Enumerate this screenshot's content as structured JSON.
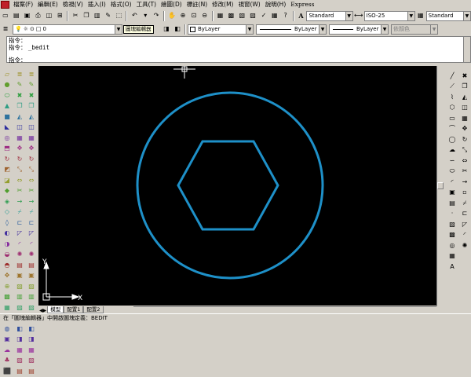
{
  "menu": [
    "檔案(F)",
    "編輯(E)",
    "檢視(V)",
    "插入(I)",
    "格式(O)",
    "工具(T)",
    "繪圖(D)",
    "標註(N)",
    "修改(M)",
    "視窗(W)",
    "說明(H)",
    "Express"
  ],
  "styles": {
    "text_style": "Standard",
    "dim_style": "ISO-25",
    "table_style": "Standard"
  },
  "layer": {
    "current": "0",
    "tooltip": "圖塊編輯器"
  },
  "properties": {
    "color": "ByLayer",
    "linetype": "ByLayer",
    "lineweight": "ByLayer",
    "plot_style": "依顏色"
  },
  "command": {
    "line1": "指令：",
    "line2_prompt": "指令：",
    "line2_cmd": "_bedit",
    "line3": "指令："
  },
  "ucs": {
    "x_label": "X",
    "y_label": "Y"
  },
  "tabs": [
    "模型",
    "配置1",
    "配置2"
  ],
  "status": "在「圖塊編輯器」中開啟圖塊定義：BEDIT",
  "colors": {
    "canvas_bg": "#000000",
    "geometry": "#1e90c8",
    "chrome": "#d4d0c8"
  },
  "icons": {
    "left_col1": [
      "plane-icon",
      "sphere-icon",
      "cylinder-icon",
      "cone-icon",
      "box-icon",
      "wedge-icon",
      "torus-icon",
      "extrude-icon",
      "revolve-icon",
      "slice-icon",
      "section-icon",
      "interfere-icon",
      "union-icon",
      "subtract-icon",
      "intersect-icon",
      "shade-icon",
      "hide-icon",
      "render-icon",
      "orbit-icon",
      "pan-icon",
      "zoom-icon",
      "view-icon",
      "camera-icon",
      "light-icon",
      "material-icon",
      "scene-icon",
      "fog-icon",
      "landscape-icon",
      "cube-icon"
    ],
    "left_col2": [
      "layer-icon",
      "match-icon",
      "erase-icon",
      "copy-icon",
      "mirror-icon",
      "offset-icon",
      "array-icon",
      "move-icon",
      "rotate-icon",
      "scale-icon",
      "stretch-icon",
      "trim-icon",
      "extend-icon",
      "break-icon",
      "join-icon",
      "chamfer-icon",
      "fillet-icon",
      "explode-icon",
      "group-icon",
      "block-icon",
      "insert-icon",
      "attribute-icon",
      "xref-icon",
      "image-icon",
      "ole-icon",
      "field-icon",
      "table-icon",
      "hatch-icon",
      "gradient-icon"
    ],
    "right_col1": [
      "line-icon",
      "xline-icon",
      "pline-icon",
      "polygon-icon",
      "rectangle-icon",
      "arc-icon",
      "circle-icon",
      "revcloud-icon",
      "spline-icon",
      "ellipse-icon",
      "ellipse-arc-icon",
      "insert-block-icon",
      "make-block-icon",
      "point-icon",
      "hatch-draw-icon",
      "gradient-draw-icon",
      "region-icon",
      "table-draw-icon",
      "mtext-icon"
    ],
    "right_col2": [
      "erase-mod-icon",
      "copy-mod-icon",
      "mirror-mod-icon",
      "offset-mod-icon",
      "array-mod-icon",
      "move-mod-icon",
      "rotate-mod-icon",
      "scale-mod-icon",
      "stretch-mod-icon",
      "trim-mod-icon",
      "extend-mod-icon",
      "break-point-icon",
      "break-mod-icon",
      "join-mod-icon",
      "chamfer-mod-icon",
      "fillet-mod-icon",
      "explode-mod-icon"
    ]
  }
}
